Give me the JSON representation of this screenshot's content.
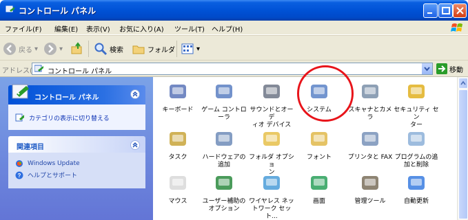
{
  "window": {
    "title": "コントロール パネル"
  },
  "menu": [
    "ファイル(F)",
    "編集(E)",
    "表示(V)",
    "お気に入り(A)",
    "ツール(T)",
    "ヘルプ(H)"
  ],
  "toolbar": {
    "back": "戻る",
    "search": "検索",
    "folders": "フォルダ"
  },
  "address": {
    "label": "アドレス(D)",
    "value": "コントロール パネル",
    "go": "移動"
  },
  "leftpane": {
    "panel1_title": "コントロール パネル",
    "switch_view": "カテゴリの表示に切り替える",
    "panel2_title": "関連項目",
    "links": [
      "Windows Update",
      "ヘルプとサポート"
    ]
  },
  "icons": [
    "キーボード",
    "ゲーム コントロ\nーラ",
    "サウンドとオーデ\nィオ デバイス",
    "システム",
    "スキャナとカメラ",
    "セキュリティ セン\nター",
    "タスク",
    "ハードウェアの\n追加",
    "フォルダ オプショ\nン",
    "フォント",
    "プリンタと FAX",
    "プログラムの追\n加と削除",
    "マウス",
    "ユーザー補助の\nオプション",
    "ワイヤレス ネッ\nトワーク セット...",
    "画面",
    "管理ツール",
    "自動更新"
  ],
  "icon_names": [
    "keyboard-icon",
    "game-controller-icon",
    "speaker-icon",
    "system-icon",
    "scanner-camera-icon",
    "security-shield-icon",
    "scheduled-tasks-icon",
    "add-hardware-icon",
    "folder-options-icon",
    "fonts-folder-icon",
    "printer-fax-icon",
    "add-remove-programs-icon",
    "mouse-icon",
    "accessibility-icon",
    "wireless-network-icon",
    "display-icon",
    "admin-tools-icon",
    "automatic-updates-icon"
  ],
  "colors": {
    "titlebar": "#0052d6",
    "highlight": "#e8141a",
    "leftpane": "#7ba2e7"
  }
}
